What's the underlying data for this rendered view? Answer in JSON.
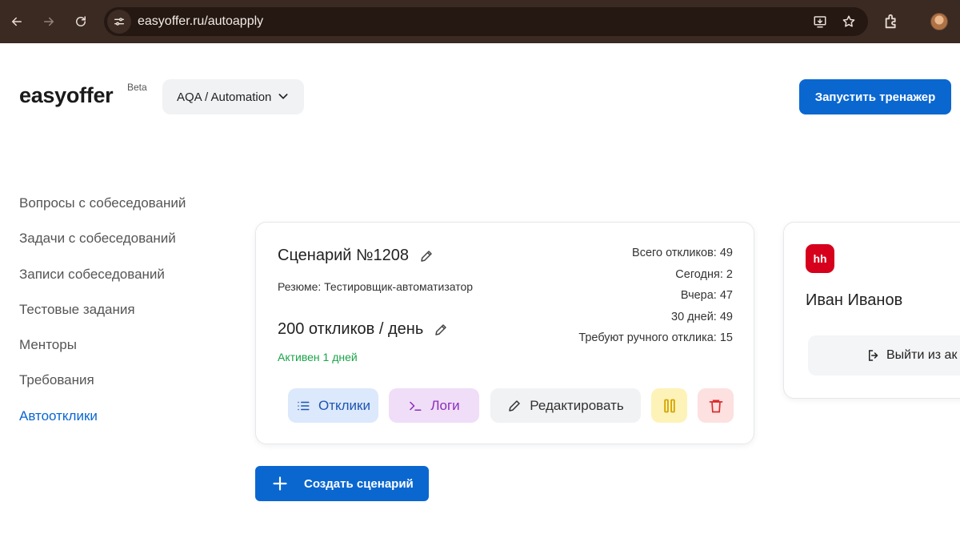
{
  "browser": {
    "url": "easyoffer.ru/autoapply",
    "icons": [
      "back-arrow-icon",
      "forward-arrow-icon",
      "reload-icon",
      "site-settings-icon",
      "install-app-icon",
      "bookmark-star-icon",
      "extensions-icon",
      "profile-avatar"
    ]
  },
  "header": {
    "logo": "easyoffer",
    "beta": "Beta",
    "role_select": "AQA / Automation",
    "start_button": "Запустить тренажер"
  },
  "sidebar": {
    "items": [
      {
        "label": "Вопросы с собеседований",
        "active": false
      },
      {
        "label": "Задачи с собеседований",
        "active": false
      },
      {
        "label": "Записи собеседований",
        "active": false
      },
      {
        "label": "Тестовые задания",
        "active": false
      },
      {
        "label": "Менторы",
        "active": false
      },
      {
        "label": "Требования",
        "active": false
      },
      {
        "label": "Автоотклики",
        "active": true
      }
    ]
  },
  "scenario": {
    "title": "Сценарий №1208",
    "resume": "Резюме: Тестировщик-автоматизатор",
    "per_day": "200 откликов / день",
    "status": "Активен 1 дней",
    "stats": [
      "Всего откликов: 49",
      "Сегодня: 2",
      "Вчера: 47",
      "30 дней: 49",
      "Требуют ручного отклика: 15"
    ],
    "actions": {
      "responses": "Отклики",
      "logs": "Логи",
      "edit": "Редактировать"
    }
  },
  "create_button": "Создать сценарий",
  "account": {
    "badge": "hh",
    "name": "Иван Иванов",
    "logout": "Выйти из ак"
  },
  "colors": {
    "accent": "#0a67d0",
    "active_status": "#1aa34a",
    "hh_brand": "#d6001c"
  }
}
